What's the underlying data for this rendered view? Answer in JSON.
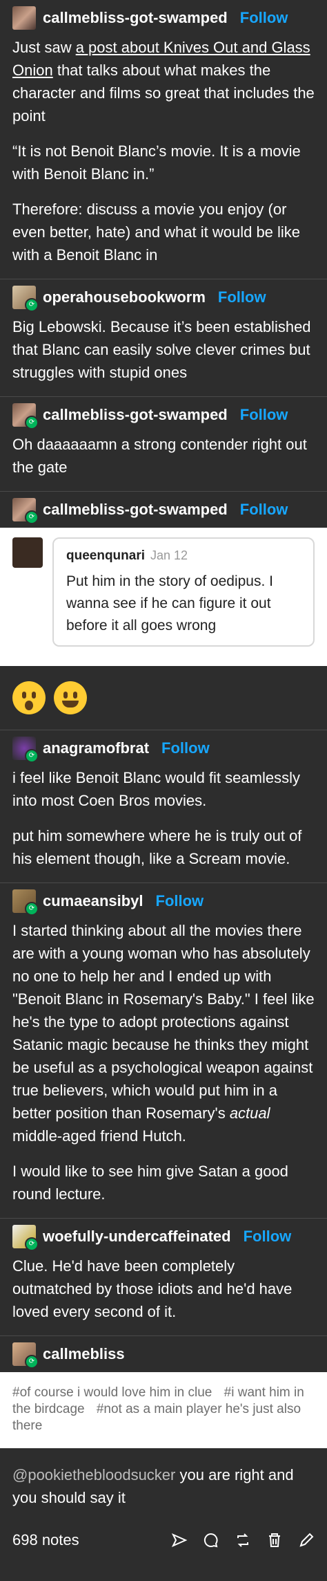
{
  "op": {
    "username": "callmebliss-got-swamped",
    "follow": "Follow",
    "p1_pre": "Just saw ",
    "p1_link": "a post about Knives Out and Glass Onion",
    "p1_post": " that talks about what makes the character and films so great that includes the point",
    "p2": "“It is not Benoit Blanc’s movie. It is a movie with Benoit Blanc in.”",
    "p3": "Therefore: discuss a movie you enjoy (or even better, hate) and what it would be like with a Benoit Blanc in"
  },
  "r1": {
    "username": "operahousebookworm",
    "follow": "Follow",
    "text": "Big Lebowski. Because it’s been established that Blanc can easily solve clever crimes but struggles with stupid ones"
  },
  "r2": {
    "username": "callmebliss-got-swamped",
    "follow": "Follow",
    "text": "Oh daaaaaamn a strong contender right out the gate"
  },
  "r3": {
    "username": "callmebliss-got-swamped",
    "follow": "Follow",
    "ask": {
      "asker": "queenqunari",
      "date": "Jan 12",
      "text": "Put him in the story of oedipus. I wanna see if he can figure it out before it all goes wrong"
    }
  },
  "r4": {
    "username": "anagramofbrat",
    "follow": "Follow",
    "p1": "i feel like Benoit Blanc would fit seamlessly into most Coen Bros movies.",
    "p2": "put him somewhere where he is truly out of his element though, like a Scream movie."
  },
  "r5": {
    "username": "cumaeansibyl",
    "follow": "Follow",
    "p1_pre": "I started thinking about all the movies there are with a young woman who has absolutely no one to help her and I ended up with \"Benoit Blanc in Rosemary's Baby.\" I feel like he's the type to adopt protections against Satanic magic because he thinks they might be useful as a psychological weapon against true believers, which would put him in a better position than Rosemary's ",
    "p1_em": "actual",
    "p1_post": " middle-aged friend Hutch.",
    "p2": "I would like to see him give Satan a good round lecture."
  },
  "r6": {
    "username": "woefully-undercaffeinated",
    "follow": "Follow",
    "text": "Clue. He'd have been completely outmatched by those idiots and he'd have loved every second of it."
  },
  "r7": {
    "username": "callmebliss",
    "tags": [
      "#of course i would love him in clue",
      "#i want him in the birdcage",
      "#not as a main player he's just also there"
    ]
  },
  "final": {
    "mention": "@pookiethebloodsucker",
    "text": " you are right and you should say it"
  },
  "footer": {
    "notes": "698 notes"
  },
  "icons": [
    "share-icon",
    "reply-icon",
    "reblog-icon",
    "delete-icon",
    "edit-icon"
  ]
}
